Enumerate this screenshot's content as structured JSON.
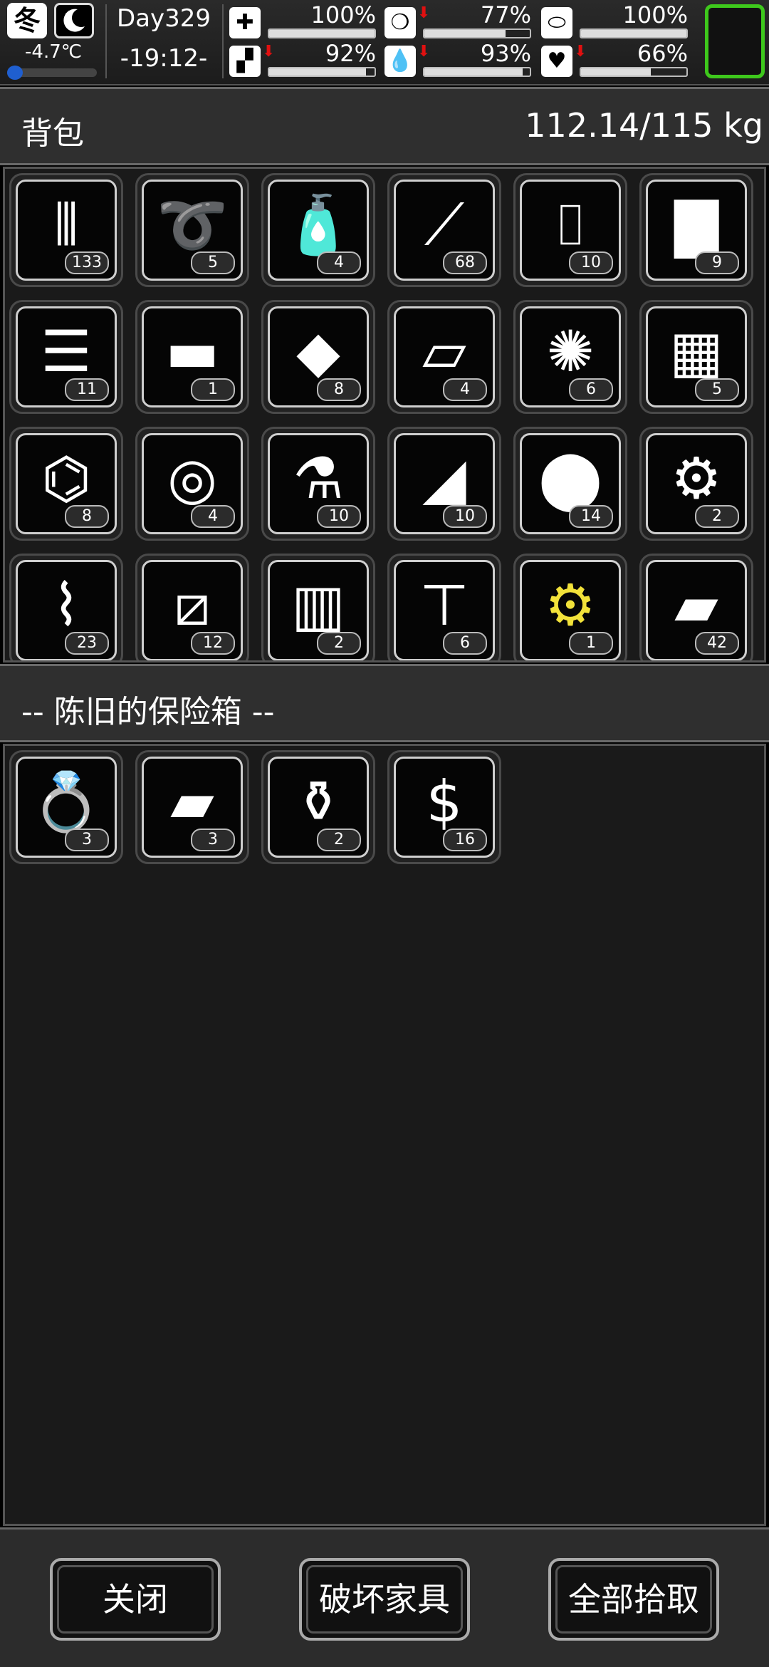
{
  "status": {
    "season": "冬",
    "temperature": "-4.7℃",
    "day": "Day329",
    "time": "-19:12-",
    "stats": [
      {
        "name": "health",
        "icon": "medkit-icon",
        "glyph": "✚",
        "value": "100%",
        "level": 100,
        "declining": false
      },
      {
        "name": "hunger",
        "icon": "stomach-icon",
        "glyph": "❍",
        "value": "77%",
        "level": 77,
        "declining": true
      },
      {
        "name": "pill",
        "icon": "pill-icon",
        "glyph": "⬭",
        "value": "100%",
        "level": 100,
        "declining": false
      },
      {
        "name": "stamina",
        "icon": "leg-icon",
        "glyph": "▞",
        "value": "92%",
        "level": 92,
        "declining": true
      },
      {
        "name": "thirst",
        "icon": "water-drop-icon",
        "glyph": "💧",
        "value": "93%",
        "level": 93,
        "declining": true
      },
      {
        "name": "mood",
        "icon": "heart-icon",
        "glyph": "♥",
        "value": "66%",
        "level": 66,
        "declining": true
      }
    ]
  },
  "backpack": {
    "title": "背包",
    "weight": "112.14/115 kg",
    "items": [
      {
        "icon": "bullets-icon",
        "glyph": "⦀",
        "qty": "133"
      },
      {
        "icon": "rope-icon",
        "glyph": "➰",
        "qty": "5"
      },
      {
        "icon": "water-bottle-icon",
        "glyph": "🧴",
        "qty": "4"
      },
      {
        "icon": "rifle-rounds-icon",
        "glyph": "⟋",
        "qty": "68"
      },
      {
        "icon": "glass-bottle-icon",
        "glyph": "⌷",
        "qty": "10"
      },
      {
        "icon": "cloth-sheet-icon",
        "glyph": "▇",
        "qty": "9"
      },
      {
        "icon": "folded-clothes-icon",
        "glyph": "☰",
        "qty": "11"
      },
      {
        "icon": "towel-icon",
        "glyph": "▬",
        "qty": "1"
      },
      {
        "icon": "ore-chunk-icon",
        "glyph": "◆",
        "qty": "8"
      },
      {
        "icon": "paper-sheets-icon",
        "glyph": "▱",
        "qty": "4"
      },
      {
        "icon": "straw-bundle-icon",
        "glyph": "✺",
        "qty": "6"
      },
      {
        "icon": "bricks-icon",
        "glyph": "▦",
        "qty": "5"
      },
      {
        "icon": "crushed-bottle-icon",
        "glyph": "⌬",
        "qty": "8"
      },
      {
        "icon": "logs-icon",
        "glyph": "◎",
        "qty": "4"
      },
      {
        "icon": "spray-bottle-icon",
        "glyph": "⚗",
        "qty": "10"
      },
      {
        "icon": "glass-shards-icon",
        "glyph": "◢",
        "qty": "10"
      },
      {
        "icon": "stones-icon",
        "glyph": "⬤",
        "qty": "14"
      },
      {
        "icon": "electronic-parts-icon",
        "glyph": "⚙",
        "qty": "2"
      },
      {
        "icon": "scrap-metal-icon",
        "glyph": "⌇",
        "qty": "23"
      },
      {
        "icon": "planks-icon",
        "glyph": "⧄",
        "qty": "12"
      },
      {
        "icon": "wood-blocks-icon",
        "glyph": "▥",
        "qty": "2"
      },
      {
        "icon": "nails-icon",
        "glyph": "⊤",
        "qty": "6"
      },
      {
        "icon": "rare-parts-icon",
        "glyph": "⚙",
        "qty": "1",
        "highlight": true
      },
      {
        "icon": "metal-plate-icon",
        "glyph": "▰",
        "qty": "42"
      }
    ]
  },
  "container": {
    "title": "-- 陈旧的保险箱 --",
    "items": [
      {
        "icon": "ring-icon",
        "glyph": "💍",
        "qty": "3"
      },
      {
        "icon": "gold-bars-icon",
        "glyph": "▰",
        "qty": "3"
      },
      {
        "icon": "vase-icon",
        "glyph": "⚱",
        "qty": "2"
      },
      {
        "icon": "cash-stack-icon",
        "glyph": "$",
        "qty": "16"
      }
    ]
  },
  "buttons": {
    "close": "关闭",
    "destroy_furniture": "破坏家具",
    "take_all": "全部拾取"
  }
}
